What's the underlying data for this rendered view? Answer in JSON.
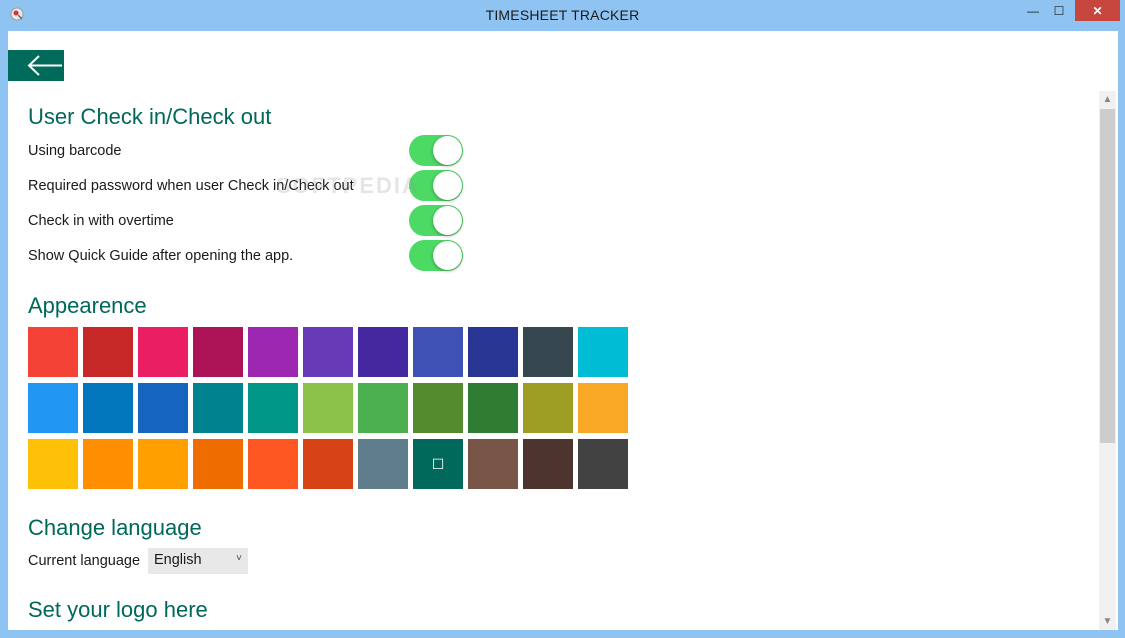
{
  "window": {
    "title": "TIMESHEET TRACKER",
    "minimize_glyph": "—",
    "maximize_glyph": "☐",
    "close_glyph": "✕"
  },
  "back_button": {
    "icon": "arrow-left-icon"
  },
  "checkin": {
    "title": "User Check in/Check out",
    "options": [
      {
        "label": "Using barcode",
        "enabled": true
      },
      {
        "label": "Required password when user Check in/Check out",
        "enabled": true
      },
      {
        "label": "Check in with overtime",
        "enabled": true
      },
      {
        "label": "Show Quick Guide after opening the app.",
        "enabled": true
      }
    ]
  },
  "watermark": "SOFTPEDIA",
  "appearance": {
    "title": "Appearence",
    "selected_index": 29,
    "selected_glyph": "☐",
    "colors": [
      "#f44336",
      "#c62828",
      "#e91e63",
      "#ad1457",
      "#9c27b0",
      "#673ab7",
      "#4527a0",
      "#3f51b5",
      "#283593",
      "#37474f",
      "#00bcd4",
      "#2196f3",
      "#0277bd",
      "#1565c0",
      "#00838f",
      "#009688",
      "#8bc34a",
      "#4caf50",
      "#558b2f",
      "#2e7d32",
      "#9e9d24",
      "#f9a825",
      "#ffc107",
      "#ff8f00",
      "#ffa000",
      "#ef6c00",
      "#ff5722",
      "#d84315",
      "#607d8b",
      "#00695c",
      "#795548",
      "#4e342e",
      "#424242"
    ]
  },
  "language": {
    "title": "Change language",
    "current_label": "Current language",
    "selected": "English",
    "chevron": "˅"
  },
  "logo": {
    "title": "Set your logo here"
  },
  "scrollbar": {
    "up_glyph": "▲",
    "down_glyph": "▼"
  }
}
